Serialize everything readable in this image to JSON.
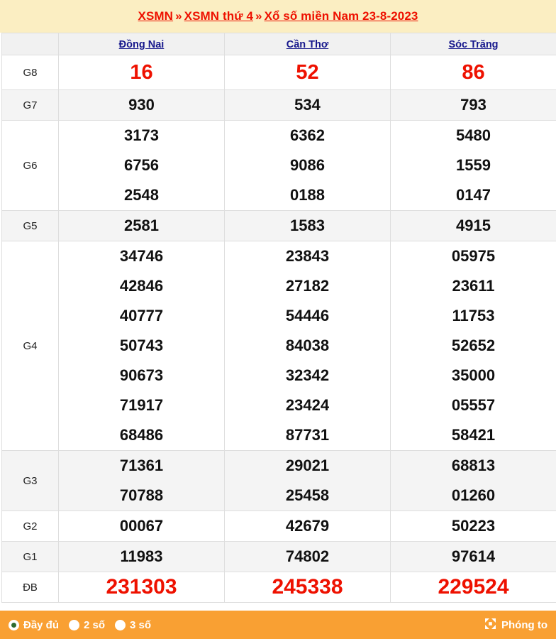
{
  "header": {
    "crumb1": "XSMN",
    "crumb2": "XSMN thứ 4",
    "crumb3": "Xổ số miền Nam 23-8-2023",
    "separator": "»"
  },
  "table": {
    "corner_label": "",
    "provinces": [
      "Đồng Nai",
      "Cần Thơ",
      "Sóc Trăng"
    ],
    "rows": [
      {
        "prize": "G8",
        "values": [
          [
            "16"
          ],
          [
            "52"
          ],
          [
            "86"
          ]
        ]
      },
      {
        "prize": "G7",
        "values": [
          [
            "930"
          ],
          [
            "534"
          ],
          [
            "793"
          ]
        ]
      },
      {
        "prize": "G6",
        "values": [
          [
            "3173",
            "6756",
            "2548"
          ],
          [
            "6362",
            "9086",
            "0188"
          ],
          [
            "5480",
            "1559",
            "0147"
          ]
        ]
      },
      {
        "prize": "G5",
        "values": [
          [
            "2581"
          ],
          [
            "1583"
          ],
          [
            "4915"
          ]
        ]
      },
      {
        "prize": "G4",
        "values": [
          [
            "34746",
            "42846",
            "40777",
            "50743",
            "90673",
            "71917",
            "68486"
          ],
          [
            "23843",
            "27182",
            "54446",
            "84038",
            "32342",
            "23424",
            "87731"
          ],
          [
            "05975",
            "23611",
            "11753",
            "52652",
            "35000",
            "05557",
            "58421"
          ]
        ]
      },
      {
        "prize": "G3",
        "values": [
          [
            "71361",
            "70788"
          ],
          [
            "29021",
            "25458"
          ],
          [
            "68813",
            "01260"
          ]
        ]
      },
      {
        "prize": "G2",
        "values": [
          [
            "00067"
          ],
          [
            "42679"
          ],
          [
            "50223"
          ]
        ]
      },
      {
        "prize": "G1",
        "values": [
          [
            "11983"
          ],
          [
            "74802"
          ],
          [
            "97614"
          ]
        ]
      },
      {
        "prize": "ĐB",
        "values": [
          [
            "231303"
          ],
          [
            "245338"
          ],
          [
            "229524"
          ]
        ]
      }
    ]
  },
  "footer": {
    "options": [
      {
        "label": "Đầy đủ",
        "selected": true
      },
      {
        "label": "2 số",
        "selected": false
      },
      {
        "label": "3 số",
        "selected": false
      }
    ],
    "zoom_label": "Phóng to"
  },
  "colors": {
    "header_bg": "#fbeec2",
    "crumb_red": "#ee1100",
    "province_blue": "#17188c",
    "number_black": "#111111",
    "highlight_red": "#ee1100",
    "footer_orange": "#f9a033",
    "alt_row": "#f4f4f4",
    "border": "#dedede",
    "radio_selected_dot": "#2e6b2e"
  }
}
